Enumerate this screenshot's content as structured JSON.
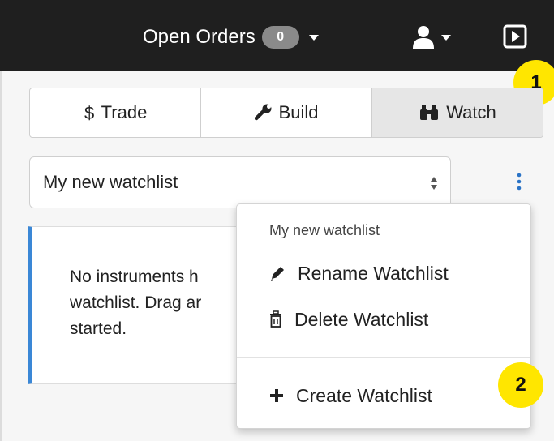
{
  "topbar": {
    "open_orders_label": "Open Orders",
    "open_orders_count": "0",
    "user_icon": "user-icon",
    "play_icon": "play-square-icon"
  },
  "tabs": [
    {
      "label": "Trade",
      "icon": "dollar-icon"
    },
    {
      "label": "Build",
      "icon": "wrench-icon"
    },
    {
      "label": "Watch",
      "icon": "binoculars-icon",
      "active": true
    }
  ],
  "watchlist_select": {
    "value": "My new watchlist"
  },
  "empty_panel": {
    "text": "No instruments h\nwatchlist. Drag ar\nstarted."
  },
  "menu": {
    "header": "My new watchlist",
    "items": [
      {
        "label": "Rename Watchlist",
        "icon": "pencil-icon"
      },
      {
        "label": "Delete Watchlist",
        "icon": "trash-icon"
      },
      {
        "label": "Create Watchlist",
        "icon": "plus-icon"
      }
    ]
  },
  "callouts": [
    "1",
    "2"
  ],
  "colors": {
    "topbar_bg": "#1f1f1f",
    "accent_blue": "#3a87d6",
    "callout_yellow": "#ffe600",
    "active_tab_bg": "#e6e6e6"
  }
}
